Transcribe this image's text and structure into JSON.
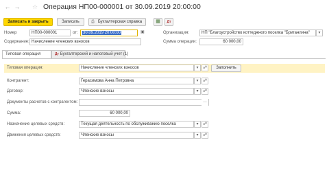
{
  "header": {
    "back_icon": "arrow-left-icon",
    "forward_icon": "arrow-right-icon",
    "favorite_icon": "star-icon",
    "title": "Операция НП00-000001 от 30.09.2019 20:00:00"
  },
  "toolbar": {
    "save_close_label": "Записать и закрыть",
    "save_label": "Записать",
    "accounting_ref_label": "Бухгалтерская справка",
    "print_icon": "printer-icon",
    "structure_icon": "document-structure-icon",
    "dt_kt_icon": "dt-kt-icon"
  },
  "form": {
    "number_label": "Номер",
    "number_value": "НП00-000001",
    "from_label": "от:",
    "date_value": "30.09.2019 20:00:00",
    "org_label": "Организация:",
    "org_value": "НП \"Благоустройство коттеджного поселка \"Бриганлина\"",
    "content_label": "Содержание:",
    "content_value": "Начисление членских взносов",
    "sum_op_label": "Сумма операции:",
    "sum_op_value": "60 000,00"
  },
  "tabs": [
    {
      "label": "Типовая операция"
    },
    {
      "label": "Бухгалтерский и налоговый учет (1)"
    }
  ],
  "details": {
    "typical_op_label": "Типовая операция:",
    "typical_op_value": "Начисление членских взносов",
    "fill_label": "Заполнить",
    "counterparty_label": "Контрагент:",
    "counterparty_value": "Герасимова Анна Петровна",
    "contract_label": "Договор:",
    "contract_value": "Членские взносы",
    "settlement_docs_label": "Документы расчетов с контрагентом:",
    "settlement_docs_value": "",
    "sum_label": "Сумма:",
    "sum_value": "60 000,00",
    "purpose_label": "Назначение целевых средств:",
    "purpose_value": "Текущая деятельность по обслуживанию поселка",
    "movement_label": "Движения целевых средств:",
    "movement_value": "Членские взносы"
  },
  "colors": {
    "primary_button": "#ffd700",
    "selection": "#3a6ec9",
    "row_highlight": "#fff3c4"
  }
}
